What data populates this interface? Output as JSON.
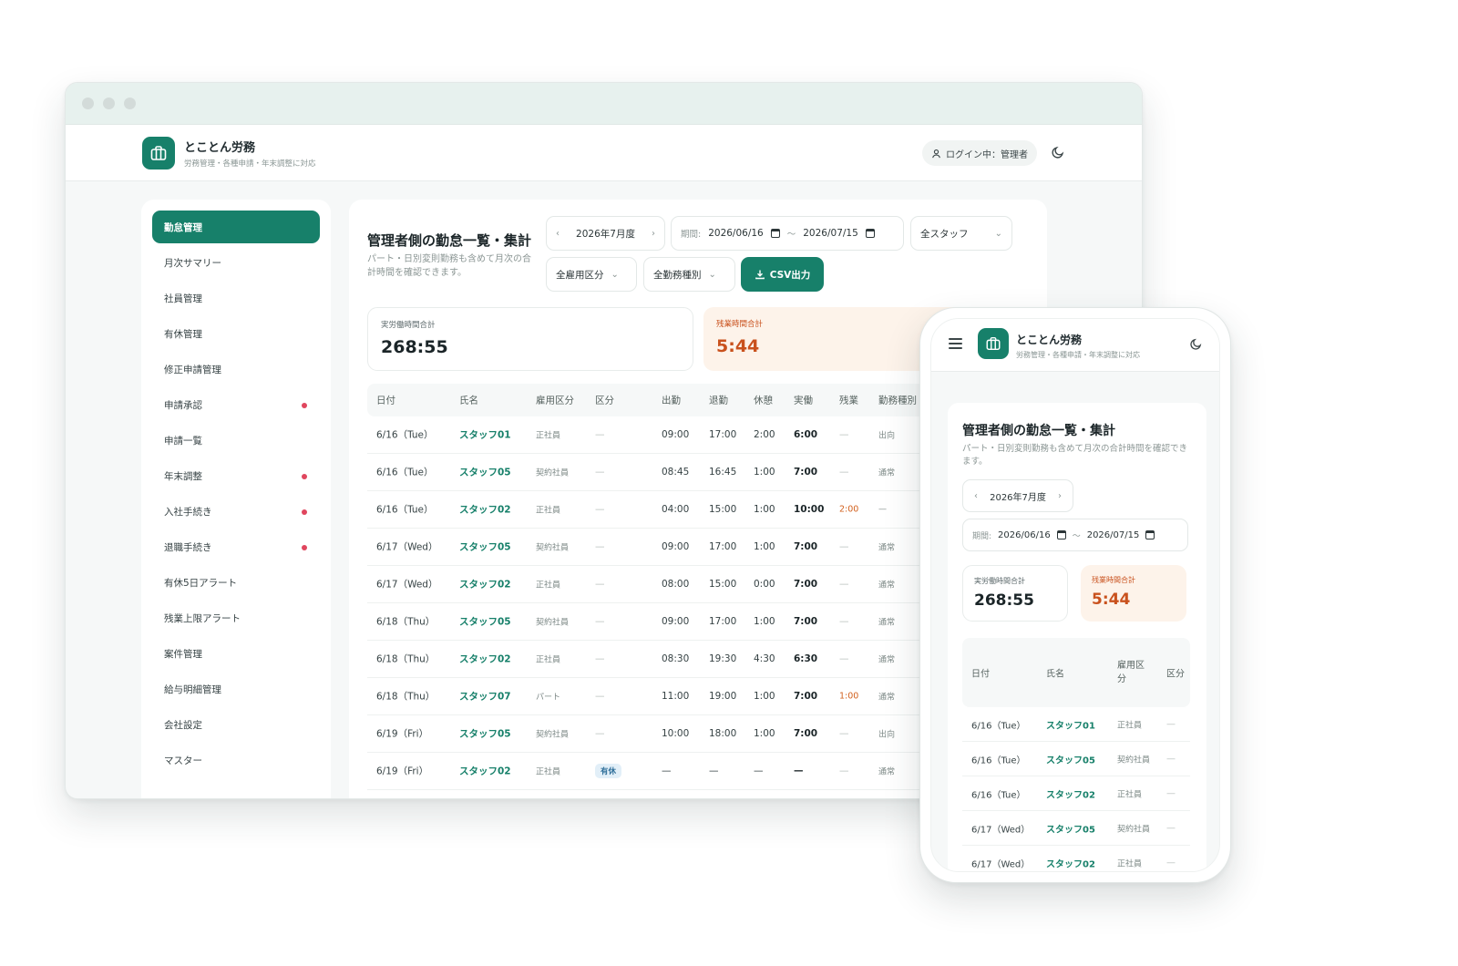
{
  "app": {
    "name": "とことん労務",
    "subtitle": "労務管理・各種申請・年末調整に対応",
    "user_label": "ログイン中：管理者"
  },
  "sidebar": {
    "items": [
      {
        "label": "勤怠管理",
        "active": true,
        "alert": false
      },
      {
        "label": "月次サマリー",
        "active": false,
        "alert": false
      },
      {
        "label": "社員管理",
        "active": false,
        "alert": false
      },
      {
        "label": "有休管理",
        "active": false,
        "alert": false
      },
      {
        "label": "修正申請管理",
        "active": false,
        "alert": false
      },
      {
        "label": "申請承認",
        "active": false,
        "alert": true
      },
      {
        "label": "申請一覧",
        "active": false,
        "alert": false
      },
      {
        "label": "年末調整",
        "active": false,
        "alert": true
      },
      {
        "label": "入社手続き",
        "active": false,
        "alert": true
      },
      {
        "label": "退職手続き",
        "active": false,
        "alert": true
      },
      {
        "label": "有休5日アラート",
        "active": false,
        "alert": false
      },
      {
        "label": "残業上限アラート",
        "active": false,
        "alert": false
      },
      {
        "label": "案件管理",
        "active": false,
        "alert": false
      },
      {
        "label": "給与明細管理",
        "active": false,
        "alert": false
      },
      {
        "label": "会社設定",
        "active": false,
        "alert": false
      },
      {
        "label": "マスター",
        "active": false,
        "alert": false
      }
    ]
  },
  "main": {
    "title": "管理者側の勤怠一覧・集計",
    "description": "パート・日別変則勤務も含めて月次の合計時間を確認できます。",
    "month": "2026年7月度",
    "period_label": "期間:",
    "period_start": "2026/06/16",
    "period_sep": "〜",
    "period_end": "2026/07/15",
    "staff_filter": "全スタッフ",
    "employment_filter": "全雇用区分",
    "worktype_filter": "全勤務種別",
    "csv_button": "CSV出力",
    "stats": {
      "actual_label": "実労働時間合計",
      "actual_value": "268:55",
      "overtime_label": "残業時間合計",
      "overtime_value": "5:44"
    },
    "table": {
      "headers": [
        "日付",
        "氏名",
        "雇用区分",
        "区分",
        "出勤",
        "退勤",
        "休憩",
        "実働",
        "残業",
        "勤務種別"
      ],
      "rows": [
        {
          "date": "6/16（Tue）",
          "name": "スタッフ01",
          "emp": "正社員",
          "cat": "—",
          "in": "09:00",
          "out": "17:00",
          "break": "2:00",
          "actual": "6:00",
          "ot": "—",
          "type": "出向"
        },
        {
          "date": "6/16（Tue）",
          "name": "スタッフ05",
          "emp": "契約社員",
          "cat": "—",
          "in": "08:45",
          "out": "16:45",
          "break": "1:00",
          "actual": "7:00",
          "ot": "—",
          "type": "通常"
        },
        {
          "date": "6/16（Tue）",
          "name": "スタッフ02",
          "emp": "正社員",
          "cat": "—",
          "in": "04:00",
          "out": "15:00",
          "break": "1:00",
          "actual": "10:00",
          "ot": "2:00",
          "type": "—"
        },
        {
          "date": "6/17（Wed）",
          "name": "スタッフ05",
          "emp": "契約社員",
          "cat": "—",
          "in": "09:00",
          "out": "17:00",
          "break": "1:00",
          "actual": "7:00",
          "ot": "—",
          "type": "通常"
        },
        {
          "date": "6/17（Wed）",
          "name": "スタッフ02",
          "emp": "正社員",
          "cat": "—",
          "in": "08:00",
          "out": "15:00",
          "break": "0:00",
          "actual": "7:00",
          "ot": "—",
          "type": "通常"
        },
        {
          "date": "6/18（Thu）",
          "name": "スタッフ05",
          "emp": "契約社員",
          "cat": "—",
          "in": "09:00",
          "out": "17:00",
          "break": "1:00",
          "actual": "7:00",
          "ot": "—",
          "type": "通常"
        },
        {
          "date": "6/18（Thu）",
          "name": "スタッフ02",
          "emp": "正社員",
          "cat": "—",
          "in": "08:30",
          "out": "19:30",
          "break": "4:30",
          "actual": "6:30",
          "ot": "—",
          "type": "通常"
        },
        {
          "date": "6/18（Thu）",
          "name": "スタッフ07",
          "emp": "パート",
          "cat": "—",
          "in": "11:00",
          "out": "19:00",
          "break": "1:00",
          "actual": "7:00",
          "ot": "1:00",
          "type": "通常"
        },
        {
          "date": "6/19（Fri）",
          "name": "スタッフ05",
          "emp": "契約社員",
          "cat": "—",
          "in": "10:00",
          "out": "18:00",
          "break": "1:00",
          "actual": "7:00",
          "ot": "—",
          "type": "出向"
        },
        {
          "date": "6/19（Fri）",
          "name": "スタッフ02",
          "emp": "正社員",
          "cat": "有休",
          "in": "—",
          "out": "—",
          "break": "—",
          "actual": "—",
          "ot": "—",
          "type": "通常"
        }
      ]
    }
  },
  "mobile": {
    "headers": [
      "日付",
      "氏名",
      "雇用区分",
      "区分"
    ],
    "rows": [
      {
        "date": "6/16（Tue）",
        "name": "スタッフ01",
        "emp": "正社員",
        "cat": "—"
      },
      {
        "date": "6/16（Tue）",
        "name": "スタッフ05",
        "emp": "契約社員",
        "cat": "—"
      },
      {
        "date": "6/16（Tue）",
        "name": "スタッフ02",
        "emp": "正社員",
        "cat": "—"
      },
      {
        "date": "6/17（Wed）",
        "name": "スタッフ05",
        "emp": "契約社員",
        "cat": "—"
      },
      {
        "date": "6/17（Wed）",
        "name": "スタッフ02",
        "emp": "正社員",
        "cat": "—"
      }
    ]
  },
  "colors": {
    "brand": "#17806a",
    "overtime": "#c9511d",
    "alert_dot": "#e0465e"
  }
}
